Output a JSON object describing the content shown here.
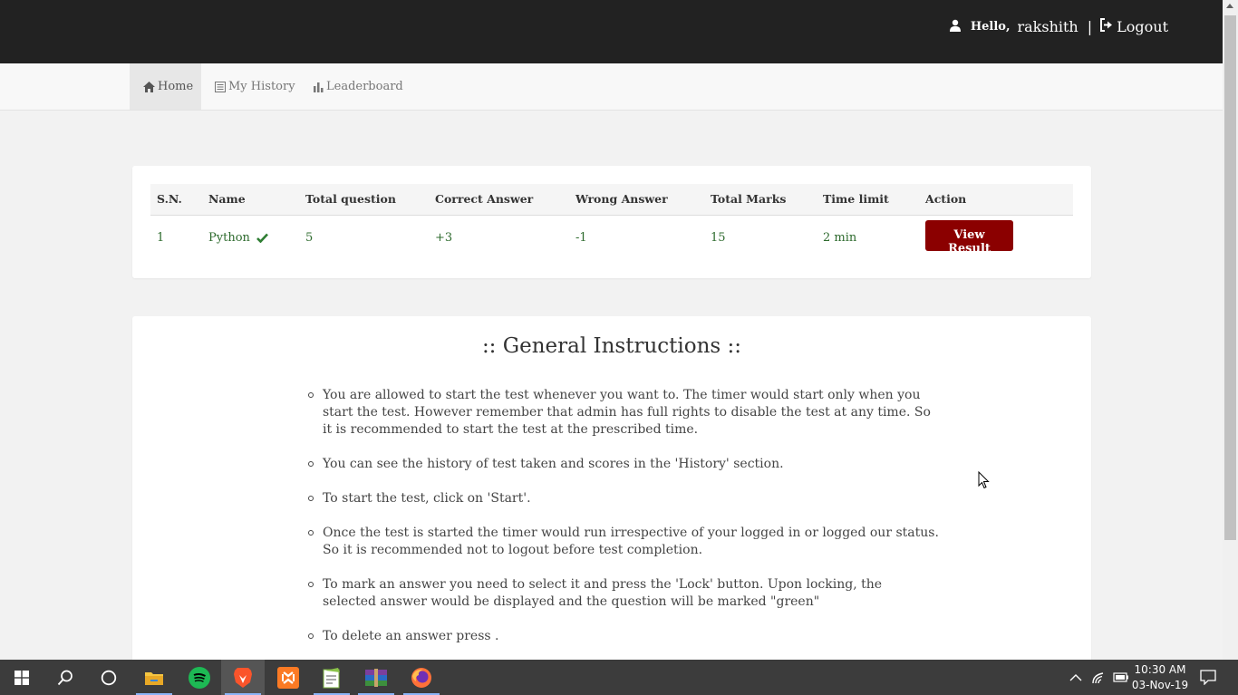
{
  "header": {
    "greeting": "Hello,",
    "username": "rakshith",
    "separator": "|",
    "logout_label": "Logout"
  },
  "nav": {
    "items": [
      {
        "label": "Home",
        "icon": "home-icon",
        "active": true
      },
      {
        "label": "My History",
        "icon": "list-icon",
        "active": false
      },
      {
        "label": "Leaderboard",
        "icon": "bar-chart-icon",
        "active": false
      }
    ]
  },
  "quiz_table": {
    "columns": [
      "S.N.",
      "Name",
      "Total question",
      "Correct Answer",
      "Wrong Answer",
      "Total Marks",
      "Time limit",
      "Action"
    ],
    "rows": [
      {
        "sn": "1",
        "name": "Python",
        "total_question": "5",
        "correct": "+3",
        "wrong": "-1",
        "total_marks": "15",
        "time_limit": "2 min",
        "action_label": "View Result"
      }
    ]
  },
  "instructions": {
    "title": ":: General Instructions ::",
    "items": [
      "You are allowed to start the test whenever you want to. The timer would start only when you start the test. However remember that admin has full rights to disable the test at any time. So it is recommended to start the test at the prescribed time.",
      "You can see the history of test taken and scores in the 'History' section.",
      "To start the test, click on 'Start'.",
      "Once the test is started the timer would run irrespective of your logged in or logged our status. So it is recommended not to logout before test completion.",
      "To mark an answer you need to select it and press the 'Lock' button. Upon locking, the selected answer would be displayed and the question will be marked \"green\"",
      "To delete an answer press ."
    ]
  },
  "taskbar": {
    "apps": [
      "start-icon",
      "search-icon",
      "cortana-icon",
      "file-explorer-icon",
      "spotify-icon",
      "brave-icon",
      "xampp-icon",
      "notepad-plus-icon",
      "winrar-icon",
      "firefox-icon"
    ],
    "time": "10:30 AM",
    "date": "03-Nov-19"
  },
  "colors": {
    "header_bg": "#222222",
    "button_bg": "#8b0000",
    "table_text": "#2e6b2e"
  }
}
